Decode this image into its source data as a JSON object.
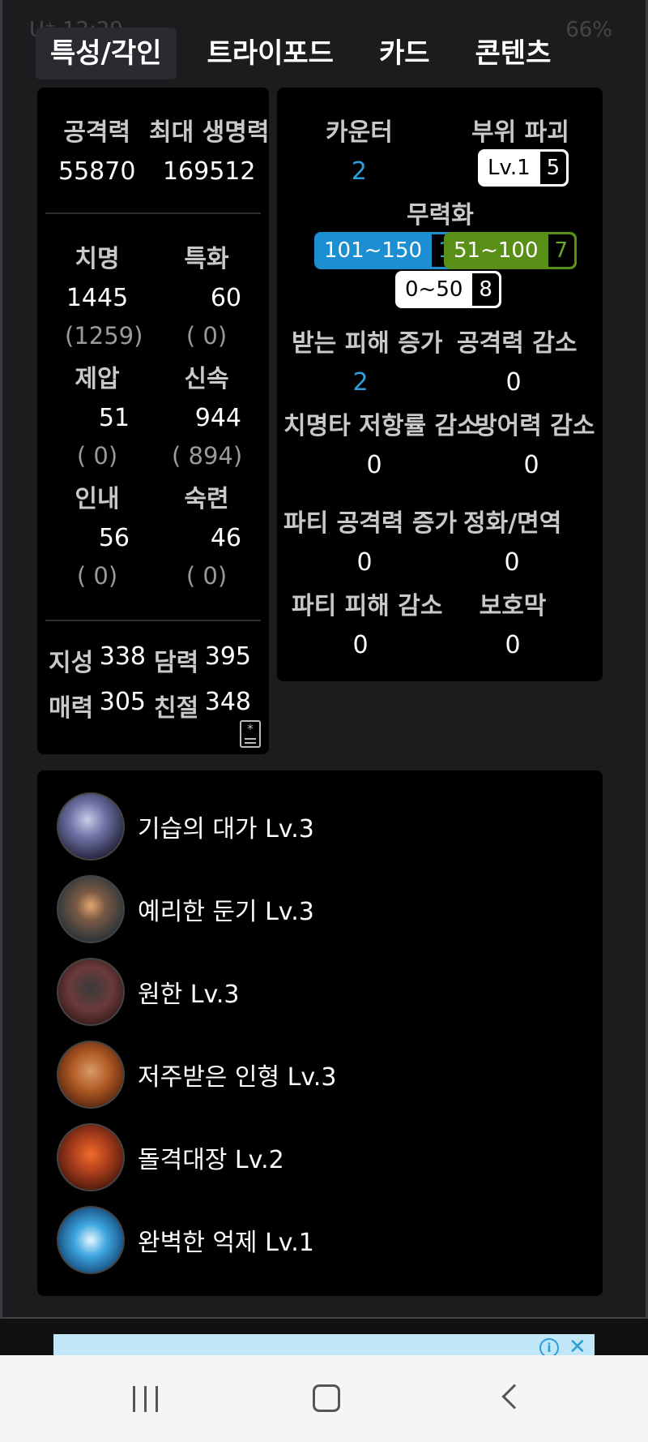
{
  "status_bar": {
    "left": "U⁺ 12:29",
    "right": "66%"
  },
  "tabs": [
    {
      "label": "특성/각인",
      "active": true
    },
    {
      "label": "트라이포드",
      "active": false
    },
    {
      "label": "카드",
      "active": false
    },
    {
      "label": "콘텐츠",
      "active": false
    }
  ],
  "stats": {
    "attack": {
      "label": "공격력",
      "value": "55870"
    },
    "max_hp": {
      "label": "최대 생명력",
      "value": "169512"
    },
    "crit": {
      "label": "치명",
      "value": "1445",
      "sub": "(1259)"
    },
    "spec": {
      "label": "특화",
      "value": "60",
      "sub": "(     0)"
    },
    "domination": {
      "label": "제압",
      "value": "51",
      "sub": "(     0)"
    },
    "swiftness": {
      "label": "신속",
      "value": "944",
      "sub": "(  894)"
    },
    "endurance": {
      "label": "인내",
      "value": "56",
      "sub": "(     0)"
    },
    "expertise": {
      "label": "숙련",
      "value": "46",
      "sub": "(     0)"
    }
  },
  "attributes": [
    {
      "k1": "지성",
      "v1": "338",
      "k2": "담력",
      "v2": "395"
    },
    {
      "k1": "매력",
      "v1": "305",
      "k2": "친절",
      "v2": "348"
    }
  ],
  "right": {
    "counter": {
      "label": "카운터",
      "value": "2"
    },
    "destruction": {
      "label": "부위 파괴",
      "pill_a": "Lv.1",
      "pill_b": "5"
    },
    "stagger": {
      "label": "무력화",
      "pills": [
        {
          "a": "101~150",
          "b": "1"
        },
        {
          "a": "51~100",
          "b": "7"
        },
        {
          "a": "0~50",
          "b": "8"
        }
      ]
    },
    "damage_taken_up": {
      "label": "받는 피해 증가",
      "value": "2"
    },
    "attack_down": {
      "label": "공격력 감소",
      "value": "0"
    },
    "crit_res_down": {
      "label": "치명타 저항률 감소",
      "value": "0"
    },
    "defense_down": {
      "label": "방어력 감소",
      "value": "0"
    },
    "party_attack_up": {
      "label": "파티 공격력 증가",
      "value": "0"
    },
    "cleanse": {
      "label": "정화/면역",
      "value": "0"
    },
    "party_damage_down": {
      "label": "파티 피해 감소",
      "value": "0"
    },
    "shield": {
      "label": "보호막",
      "value": "0"
    }
  },
  "engravings": [
    {
      "label": "기습의 대가 Lv.3",
      "icon": "master-ambush-icon",
      "color": "#6d6fa3"
    },
    {
      "label": "예리한 둔기 Lv.3",
      "icon": "keen-blunt-weapon-icon",
      "color": "#7a5a45"
    },
    {
      "label": "원한 Lv.3",
      "icon": "grudge-icon",
      "color": "#6b3a3a"
    },
    {
      "label": "저주받은 인형 Lv.3",
      "icon": "cursed-doll-icon",
      "color": "#b05a24"
    },
    {
      "label": "돌격대장 Lv.2",
      "icon": "raid-captain-icon",
      "color": "#a83d1c"
    },
    {
      "label": "완벽한 억제 Lv.1",
      "icon": "perfect-suppression-icon",
      "color": "#3ea7e0"
    }
  ]
}
